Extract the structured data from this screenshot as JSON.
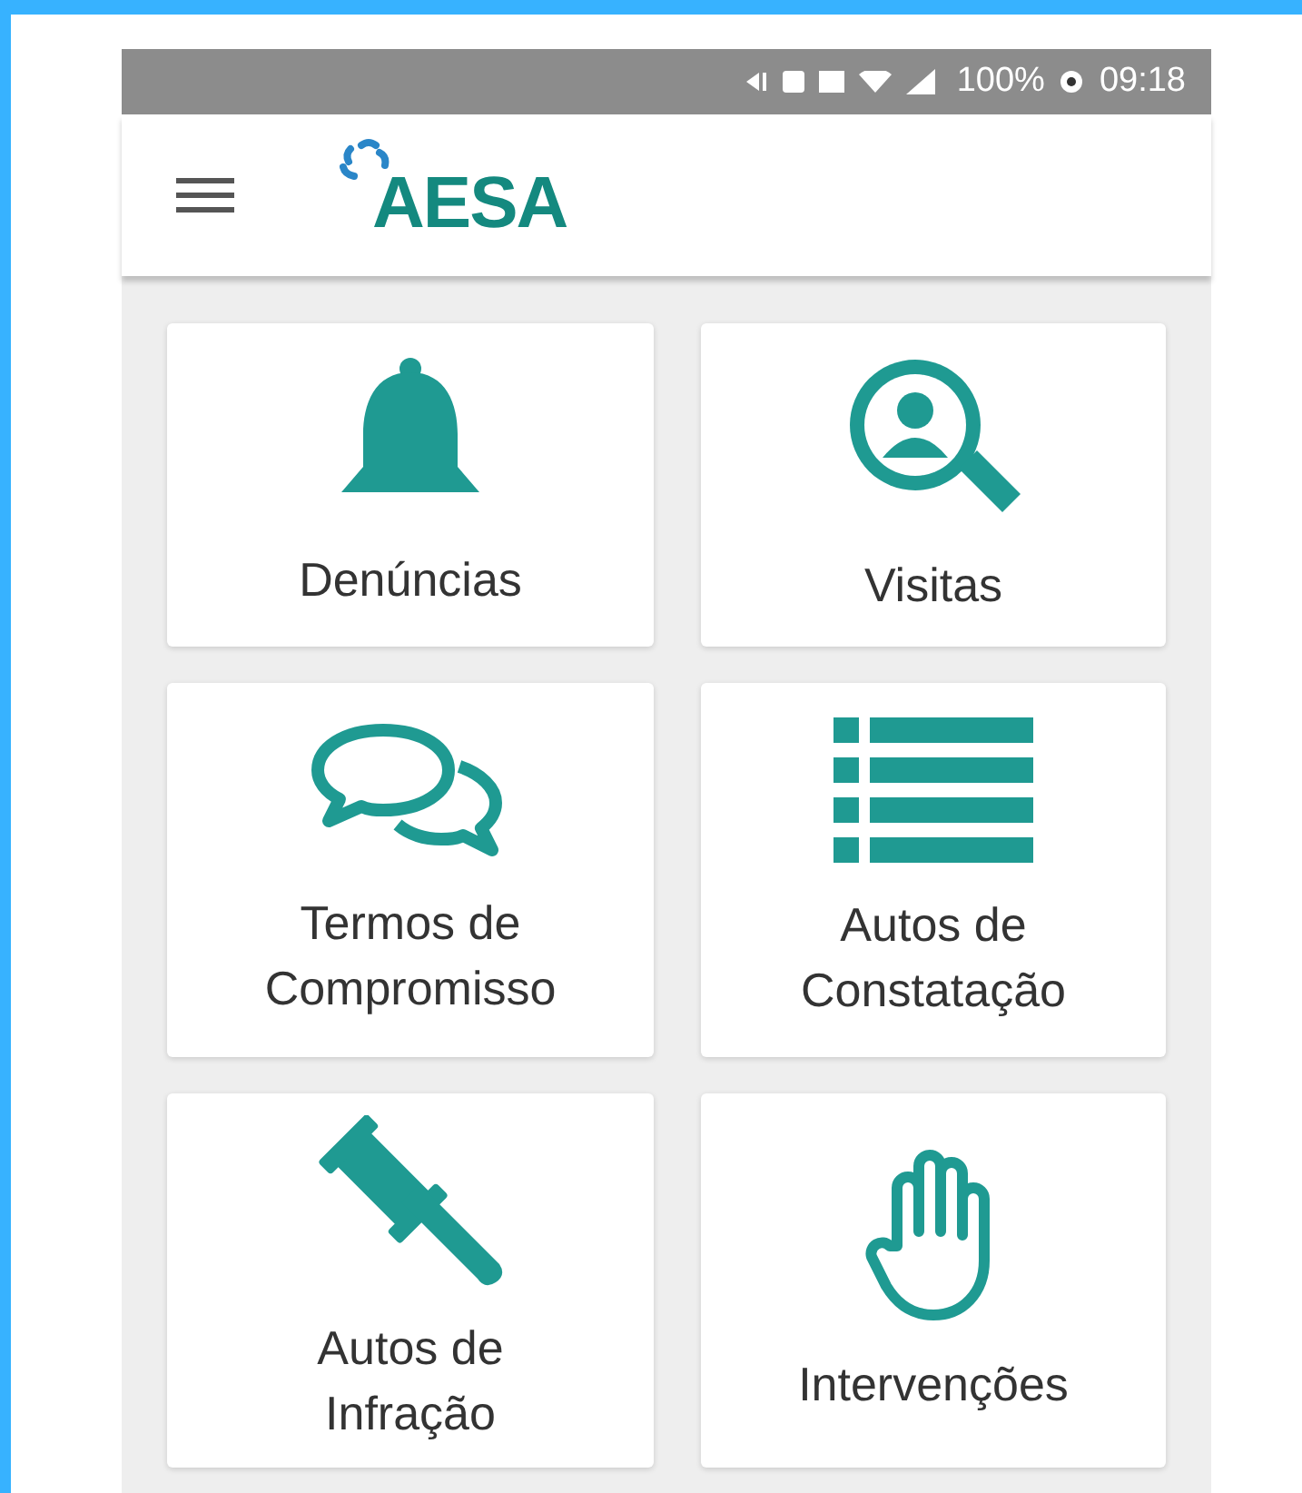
{
  "status_bar": {
    "battery": "100%",
    "time": "09:18"
  },
  "app_bar": {
    "logo": "AESA"
  },
  "tiles": [
    {
      "kind": "bell",
      "label": "Denúncias"
    },
    {
      "kind": "search",
      "label": "Visitas"
    },
    {
      "kind": "chat",
      "label": "Termos de\nCompromisso"
    },
    {
      "kind": "list",
      "label": "Autos de\nConstatação"
    },
    {
      "kind": "gavel",
      "label": "Autos de\nInfração"
    },
    {
      "kind": "hand",
      "label": "Intervenções"
    }
  ]
}
